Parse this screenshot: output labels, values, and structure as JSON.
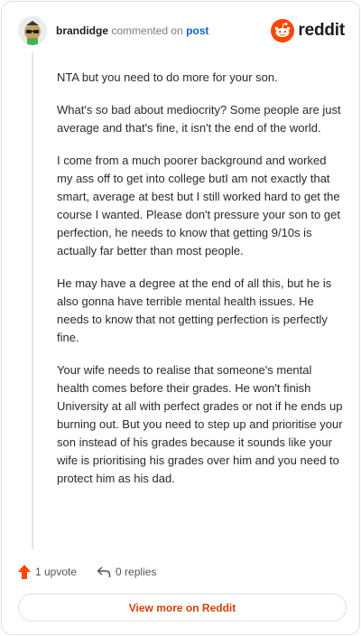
{
  "header": {
    "username": "brandidge",
    "verb": "commented on",
    "target": "post",
    "logo_text": "reddit"
  },
  "comment": {
    "paragraphs": [
      "NTA but you need to do more for your son.",
      "What's so bad about mediocrity? Some people are just average and that's fine, it isn't the end of the world.",
      "I come from a much poorer background and worked my ass off to get into college butI am not exactly that smart, average at best but I still worked hard to get the course I wanted. Please don't pressure your son to get perfection, he needs to know that getting 9/10s is actually far better than most people.",
      "He may have a degree at the end of all this, but he is also gonna have terrible mental health issues. He needs to know that not getting perfection is perfectly fine.",
      "Your wife needs to realise that someone's mental health comes before their grades. He won't finish University at all with perfect grades or not if he ends up burning out. But you need to step up and prioritise your son instead of his grades because it sounds like your wife is prioritising his grades over him and you need to protect him as his dad."
    ]
  },
  "actions": {
    "upvote_label": "1 upvote",
    "replies_label": "0 replies"
  },
  "footer": {
    "view_more_label": "View more on Reddit"
  },
  "colors": {
    "brand": "#ff4500",
    "link": "#0a66c2",
    "cta": "#d93a00"
  },
  "icons": [
    "avatar-icon",
    "reddit-logo-icon",
    "upvote-arrow-icon",
    "reply-icon"
  ]
}
